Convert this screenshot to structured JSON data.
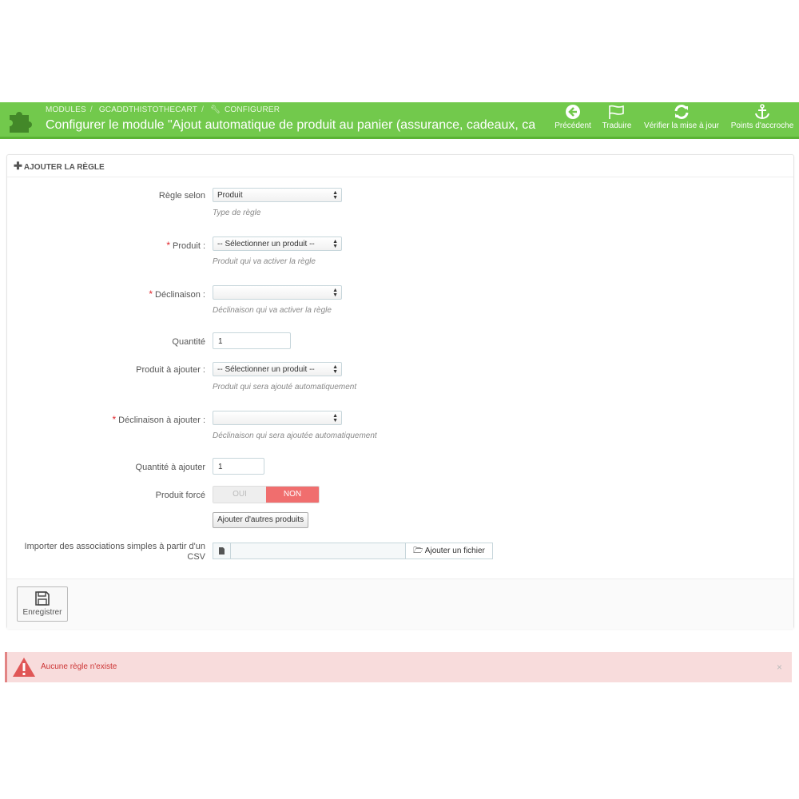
{
  "header": {
    "breadcrumbs": [
      "MODULES",
      "GCADDTHISTOTHECART",
      "CONFIGURER"
    ],
    "title": "Configurer le module \"Ajout automatique de produit au panier (assurance, cadeaux, ca",
    "toolbar": [
      {
        "label": "Précédent",
        "icon": "arrow-left-circle-icon"
      },
      {
        "label": "Traduire",
        "icon": "flag-icon"
      },
      {
        "label": "Vérifier la mise à jour",
        "icon": "refresh-icon"
      },
      {
        "label": "Points d'accroche",
        "icon": "anchor-icon"
      }
    ]
  },
  "panel": {
    "heading": "AJOUTER LA RÈGLE",
    "fields": {
      "rule_by": {
        "label": "Règle selon",
        "value": "Produit",
        "help": "Type de règle"
      },
      "product": {
        "label": "Produit :",
        "value": "-- Sélectionner un produit --",
        "help": "Produit qui va activer la règle"
      },
      "declension": {
        "label": "Déclinaison :",
        "value": "",
        "help": "Déclinaison qui va activer la règle"
      },
      "quantity": {
        "label": "Quantité",
        "value": "1"
      },
      "product_to_add": {
        "label": "Produit à ajouter :",
        "value": "-- Sélectionner un produit --",
        "help": "Produit qui sera ajouté automatiquement"
      },
      "declension_to_add": {
        "label": "Déclinaison à ajouter :",
        "value": "",
        "help": "Déclinaison qui sera ajoutée automatiquement"
      },
      "quantity_to_add": {
        "label": "Quantité à ajouter",
        "value": "1"
      },
      "forced_product": {
        "label": "Produit forcé",
        "yes": "OUI",
        "no": "NON",
        "selected": "NON"
      },
      "add_other_products": "Ajouter d'autres produits",
      "import_csv": {
        "label": "Importer des associations simples à partir d'un CSV",
        "button": "Ajouter un fichier"
      }
    },
    "save_label": "Enregistrer"
  },
  "alert": {
    "message": "Aucune règle n'existe",
    "close": "×"
  },
  "colors": {
    "header_green": "#72c94c",
    "required_red": "#e0262c",
    "switch_no": "#f06e6e",
    "alert_bg": "#f8dcdc"
  }
}
